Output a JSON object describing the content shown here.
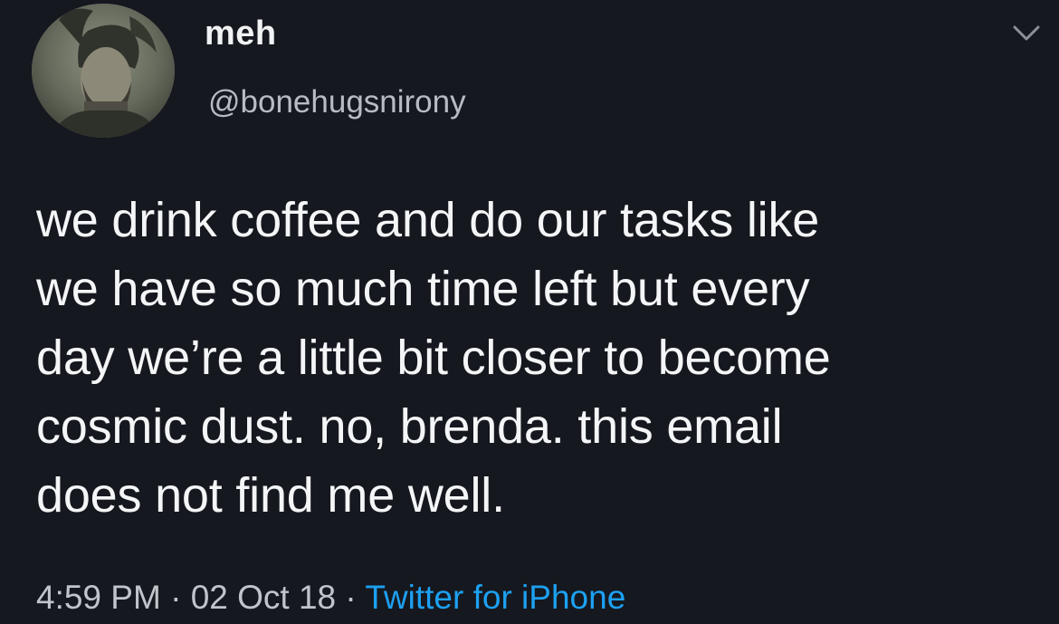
{
  "tweet": {
    "display_name": "meh",
    "handle": "@bonehugsnirony",
    "text": "we drink coffee and do our tasks like\nwe have so much time left but every\nday we’re a little bit closer to become\ncosmic dust. no, brenda. this email\ndoes not find me well.",
    "time": "4:59 PM",
    "separator": "·",
    "date": "02 Oct 18",
    "source": "Twitter for iPhone"
  },
  "icons": {
    "menu": "chevron-down-icon",
    "avatar": "avatar"
  },
  "colors": {
    "background": "#15181f",
    "text": "#f4f5f6",
    "secondary_text": "#b7bcc3",
    "link": "#1da1f2"
  }
}
